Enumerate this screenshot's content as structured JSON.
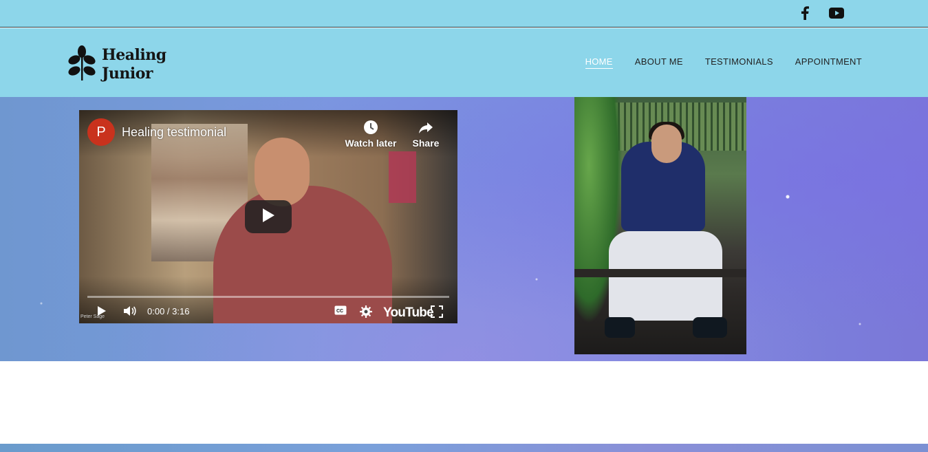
{
  "topbar": {
    "social": [
      {
        "icon": "facebook-icon"
      },
      {
        "icon": "youtube-icon"
      }
    ]
  },
  "brand": {
    "line1": "Healing",
    "line2": "Junior",
    "icon": "leaf-plant-icon"
  },
  "nav": {
    "items": [
      {
        "label": "HOME",
        "active": true
      },
      {
        "label": "ABOUT ME",
        "active": false
      },
      {
        "label": "TESTIMONIALS",
        "active": false
      },
      {
        "label": "APPOINTMENT",
        "active": false
      }
    ]
  },
  "video": {
    "channel_initial": "P",
    "title": "Healing testimonial",
    "watch_later_label": "Watch later",
    "share_label": "Share",
    "time": "0:00 / 3:16",
    "platform": "YouTube",
    "credit": "Peter Sage"
  },
  "colors": {
    "header_bg": "#8dd6ea",
    "nav_active": "#ffffff",
    "channel_avatar": "#c9321d"
  }
}
